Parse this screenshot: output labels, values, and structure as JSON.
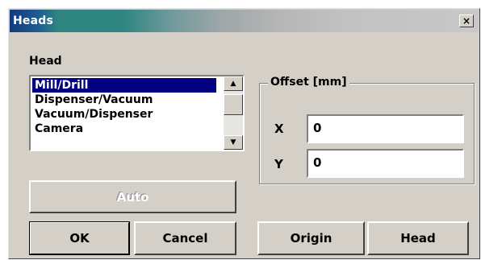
{
  "window": {
    "title": "Heads",
    "close_label": "×"
  },
  "head_section": {
    "label": "Head",
    "items": [
      {
        "label": "Mill/Drill",
        "selected": true
      },
      {
        "label": "Dispenser/Vacuum",
        "selected": false
      },
      {
        "label": "Vacuum/Dispenser",
        "selected": false
      },
      {
        "label": "Camera",
        "selected": false
      }
    ]
  },
  "offset": {
    "caption": "Offset [mm]",
    "x_label": "X",
    "x_value": "0",
    "y_label": "Y",
    "y_value": "0"
  },
  "buttons": {
    "auto": "Auto",
    "ok": "OK",
    "cancel": "Cancel",
    "origin": "Origin",
    "head": "Head"
  },
  "scrollbar": {
    "up_icon": "▲",
    "down_icon": "▼"
  }
}
